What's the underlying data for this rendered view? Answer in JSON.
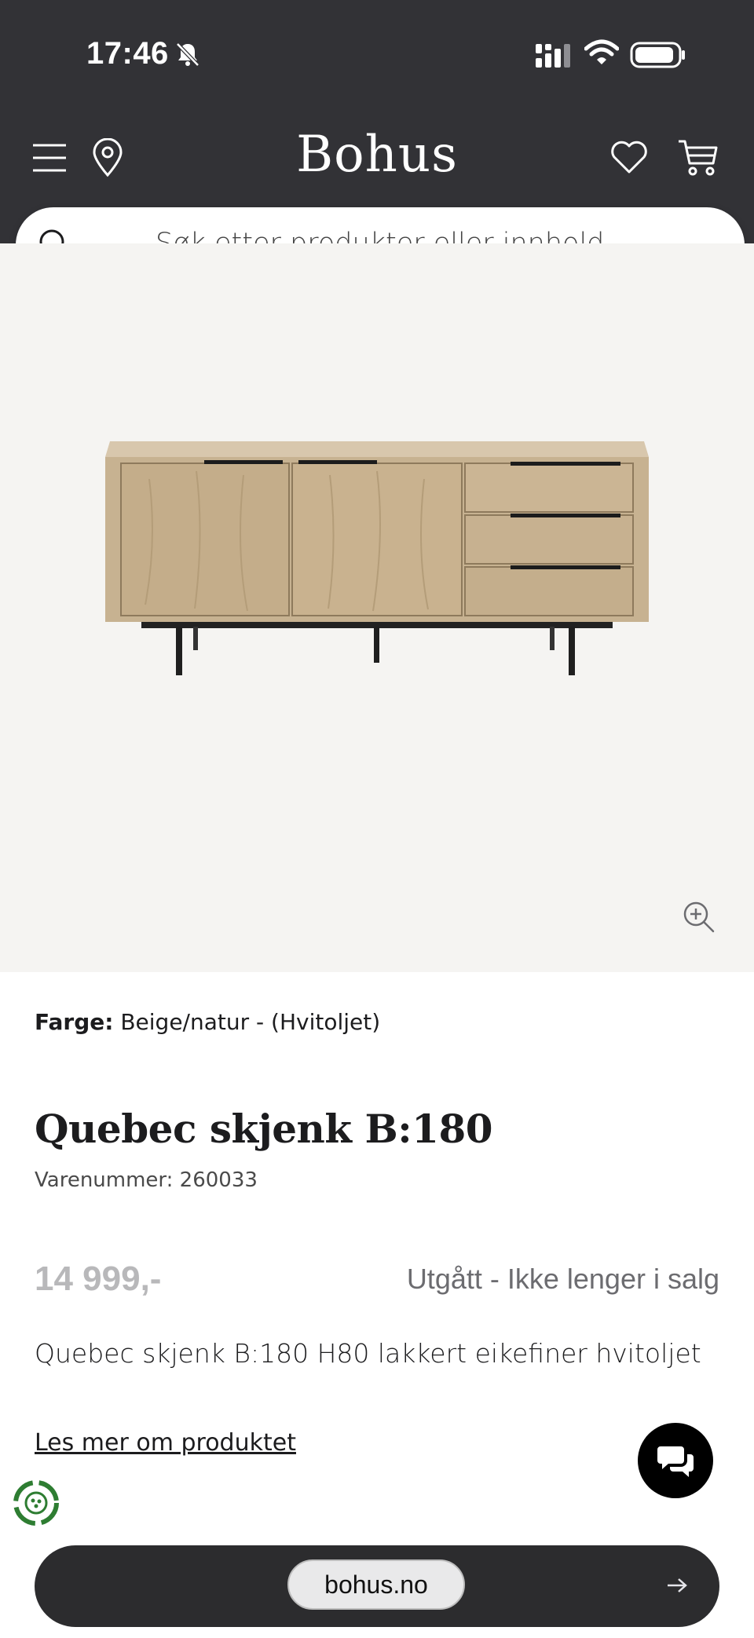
{
  "status_bar": {
    "time": "17:46"
  },
  "header": {
    "logo": "Bohus"
  },
  "search": {
    "placeholder": "Søk etter produkter eller innhold ..."
  },
  "product": {
    "color_label": "Farge:",
    "color_value": "Beige/natur - (Hvitoljet)",
    "title": "Quebec skjenk B:180",
    "sku": "Varenummer: 260033",
    "price": "14 999,-",
    "stock_status": "Utgått - Ikke lenger i salg",
    "description": "Quebec skjenk B:180 H80 lakkert eikefiner hvitoljet",
    "read_more": "Les mer om produktet"
  },
  "browser": {
    "url": "bohus.no"
  },
  "colors": {
    "header_bg": "#323236",
    "image_bg": "#f5f4f2",
    "price_muted": "#b8b8ba",
    "status_muted": "#6c6c70"
  }
}
